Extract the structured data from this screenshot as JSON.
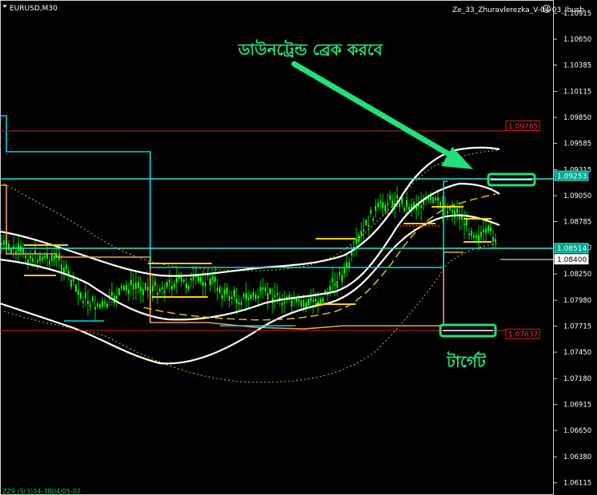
{
  "symbol_label": "EURUSD,M30",
  "indicator_label": "Ze_33_Zhuravlerezka_V-04-03_Ibush",
  "indicator_icon": "smiley-icon",
  "footer_label": "ZZ9 (Sr3)34-3B04/05-02",
  "annotations": {
    "downtrend_text": "ডাউনট্রেন্ড ব্রেক করবে",
    "target_text": "টার্গেট"
  },
  "colors": {
    "background": "#000000",
    "candle": "#00ff00",
    "accent_annotation": "#00e676",
    "resistance_line": "#00e5e5",
    "support_line": "#ff2a2a",
    "bands": "#ffffff",
    "yellow": "#ffdd00",
    "orange": "#ffa040"
  },
  "price_axis": {
    "ticks": [
      "1.10915",
      "1.10650",
      "1.10385",
      "1.10115",
      "1.09850",
      "1.09585",
      "1.09315",
      "1.09050",
      "1.08785",
      "1.08520",
      "1.08250",
      "1.07980",
      "1.07715",
      "1.07450",
      "1.07180",
      "1.06915",
      "1.06650",
      "1.06380",
      "1.06115"
    ],
    "tags": [
      {
        "value": "1.09765",
        "style": "red"
      },
      {
        "value": "1.09253",
        "style": "cyan"
      },
      {
        "value": "1.08514",
        "style": "cyan"
      },
      {
        "value": "1.08400",
        "style": "white"
      },
      {
        "value": "1.07637",
        "style": "red"
      }
    ]
  },
  "chart_data": {
    "type": "candlestick",
    "y_range": [
      1.0599,
      1.1105
    ],
    "horizontal_levels": [
      {
        "price": 1.09765,
        "kind": "resistance-red"
      },
      {
        "price": 1.09253,
        "kind": "resistance-cyan"
      },
      {
        "price": 1.08514,
        "kind": "support-cyan"
      },
      {
        "price": 1.07637,
        "kind": "target-red"
      }
    ],
    "current_price": 1.084
  }
}
